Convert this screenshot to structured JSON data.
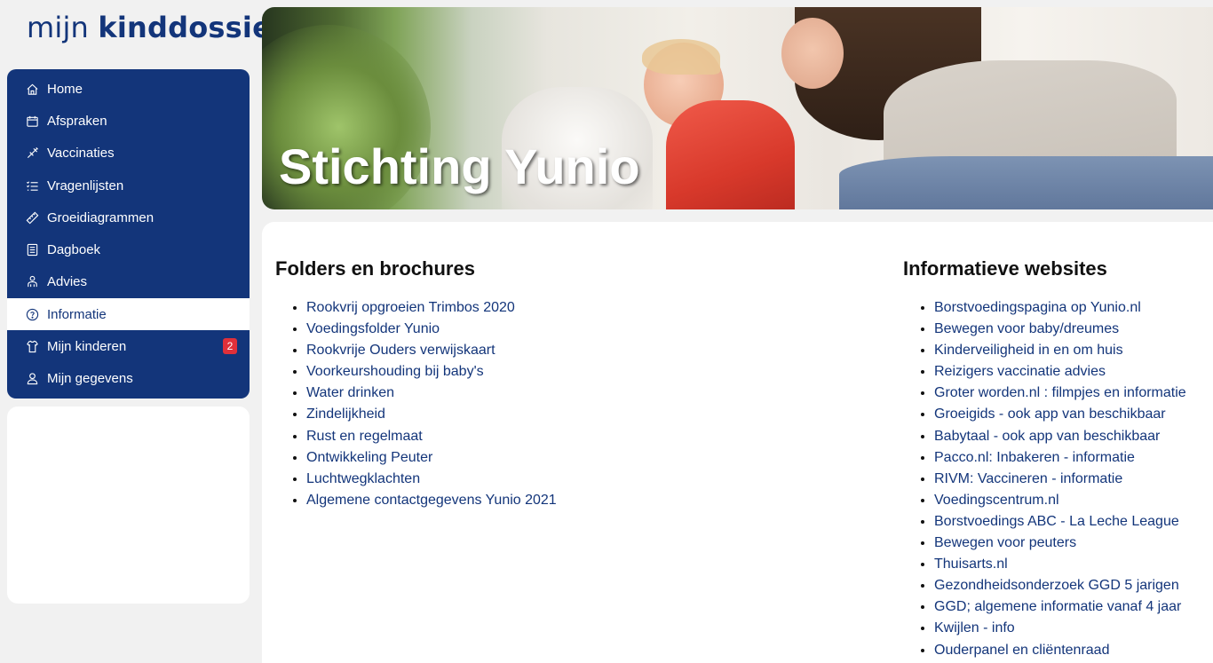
{
  "logo": {
    "light": "mijn ",
    "bold": "kinddossier"
  },
  "nav": {
    "items": [
      {
        "label": "Home",
        "icon": "home-icon"
      },
      {
        "label": "Afspraken",
        "icon": "calendar-icon"
      },
      {
        "label": "Vaccinaties",
        "icon": "syringe-icon"
      },
      {
        "label": "Vragenlijsten",
        "icon": "checklist-icon"
      },
      {
        "label": "Groeidiagrammen",
        "icon": "ruler-icon"
      },
      {
        "label": "Dagboek",
        "icon": "notebook-icon"
      },
      {
        "label": "Advies",
        "icon": "advice-icon"
      },
      {
        "label": "Informatie",
        "icon": "help-circle-icon",
        "active": true
      },
      {
        "label": "Mijn kinderen",
        "icon": "child-icon",
        "badge": "2"
      },
      {
        "label": "Mijn gegevens",
        "icon": "user-icon"
      }
    ],
    "badge_color": "#e0303a"
  },
  "hero": {
    "title": "Stichting Yunio"
  },
  "folders": {
    "heading": "Folders en brochures",
    "links": [
      "Rookvrij opgroeien Trimbos 2020",
      "Voedingsfolder Yunio",
      "Rookvrije Ouders verwijskaart",
      "Voorkeurshouding bij baby's",
      "Water drinken",
      "Zindelijkheid",
      "Rust en regelmaat",
      "Ontwikkeling Peuter",
      "Luchtwegklachten",
      "Algemene contactgegevens Yunio 2021"
    ]
  },
  "websites": {
    "heading": "Informatieve websites",
    "links": [
      "Borstvoedingspagina op Yunio.nl",
      "Bewegen voor baby/dreumes",
      "Kinderveiligheid in en om huis",
      "Reizigers vaccinatie advies",
      "Groter worden.nl : filmpjes en informatie",
      "Groeigids - ook app van beschikbaar",
      "Babytaal - ook app van beschikbaar",
      "Pacco.nl: Inbakeren - informatie",
      "RIVM: Vaccineren - informatie",
      "Voedingscentrum.nl",
      "Borstvoedings ABC - La Leche League",
      "Bewegen voor peuters",
      "Thuisarts.nl",
      "Gezondheidsonderzoek GGD 5 jarigen",
      "GGD; algemene informatie vanaf 4 jaar",
      "Kwijlen - info",
      "Ouderpanel en cliëntenraad"
    ]
  },
  "colors": {
    "brand": "#13357a",
    "link": "#13357a",
    "background": "#f1f1f1"
  }
}
